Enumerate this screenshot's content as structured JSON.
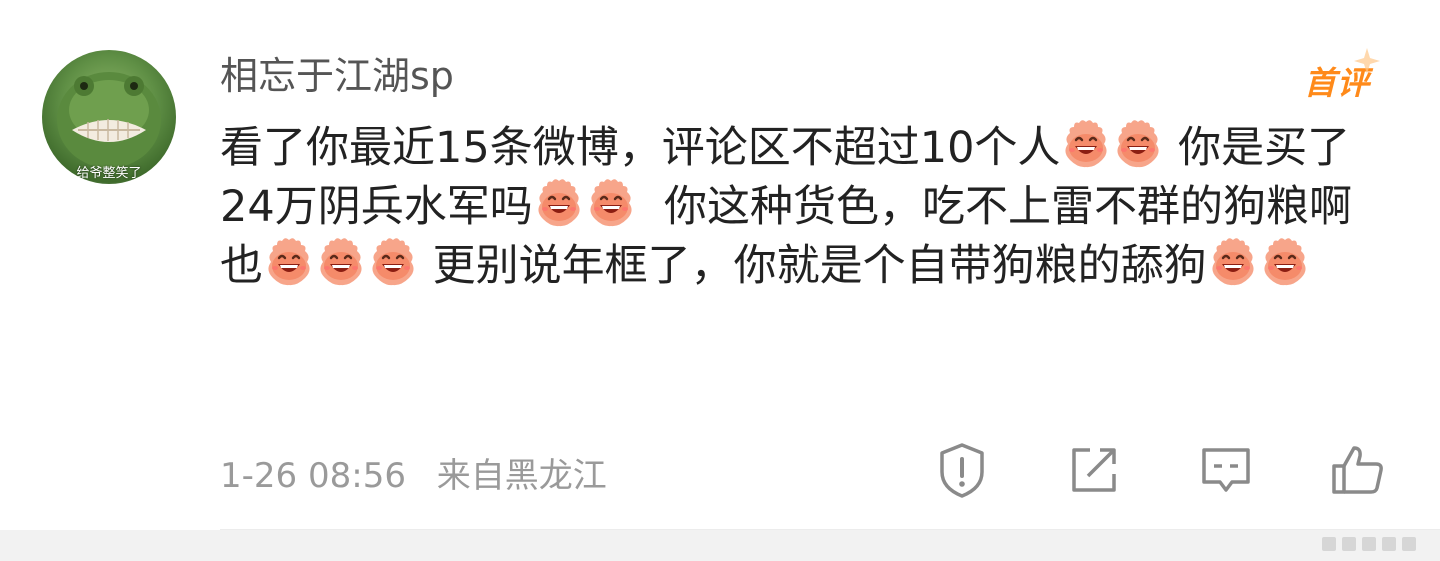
{
  "comment": {
    "avatar_caption": "给爷整笑了",
    "username": "相忘于江湖sp",
    "first_badge": "首评",
    "body_segments": [
      {
        "type": "text",
        "value": "看了你最近15条微博，评论区不超过10个人"
      },
      {
        "type": "emoji",
        "name": "laugh-emoji"
      },
      {
        "type": "emoji",
        "name": "laugh-emoji"
      },
      {
        "type": "text",
        "value": " 你是买了24万阴兵水军吗"
      },
      {
        "type": "emoji",
        "name": "laugh-emoji"
      },
      {
        "type": "emoji",
        "name": "laugh-emoji"
      },
      {
        "type": "text",
        "value": "  你这种货色，吃不上雷不群的狗粮啊也"
      },
      {
        "type": "emoji",
        "name": "laugh-emoji"
      },
      {
        "type": "emoji",
        "name": "laugh-emoji"
      },
      {
        "type": "emoji",
        "name": "laugh-emoji"
      },
      {
        "type": "text",
        "value": " 更别说年框了，你就是个自带狗粮的舔狗"
      },
      {
        "type": "emoji",
        "name": "laugh-emoji"
      },
      {
        "type": "emoji",
        "name": "laugh-emoji"
      }
    ],
    "timestamp": "1-26 08:56",
    "location": "来自黑龙江",
    "actions": [
      "report-icon",
      "share-icon",
      "comment-icon",
      "like-icon"
    ]
  },
  "colors": {
    "username": "#555555",
    "body": "#222222",
    "meta": "#9a9a9a",
    "badge": "#ff8a1a",
    "icon": "#8a8a8a"
  }
}
